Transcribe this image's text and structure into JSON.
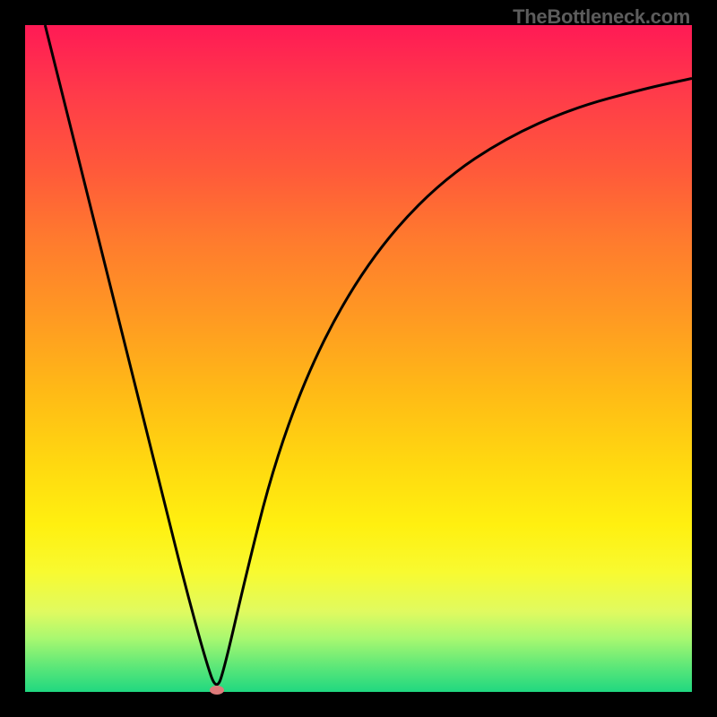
{
  "watermark": "TheBottleneck.com",
  "chart_data": {
    "type": "line",
    "title": "",
    "xlabel": "",
    "ylabel": "",
    "xlim": [
      0,
      1
    ],
    "ylim": [
      0,
      1
    ],
    "axes_hidden": true,
    "grid": false,
    "gradient_background": {
      "direction": "vertical",
      "stops": [
        {
          "pos": 0.0,
          "color": "#ff1a55"
        },
        {
          "pos": 0.5,
          "color": "#ffba16"
        },
        {
          "pos": 0.8,
          "color": "#fff010"
        },
        {
          "pos": 1.0,
          "color": "#20d880"
        }
      ]
    },
    "series": [
      {
        "name": "bottleneck-curve",
        "type": "line",
        "x": [
          0.03,
          0.06,
          0.09,
          0.12,
          0.15,
          0.18,
          0.21,
          0.24,
          0.27,
          0.287,
          0.3,
          0.33,
          0.37,
          0.42,
          0.48,
          0.55,
          0.63,
          0.72,
          0.82,
          0.93,
          1.0
        ],
        "y": [
          1.0,
          0.88,
          0.76,
          0.64,
          0.52,
          0.4,
          0.28,
          0.16,
          0.05,
          0.0,
          0.04,
          0.17,
          0.33,
          0.47,
          0.59,
          0.69,
          0.77,
          0.83,
          0.875,
          0.905,
          0.92
        ],
        "color": "#000000",
        "stroke_width": 3
      }
    ],
    "markers": [
      {
        "name": "min-marker",
        "x": 0.287,
        "y": 0.0,
        "color": "#df7a7a"
      }
    ]
  }
}
